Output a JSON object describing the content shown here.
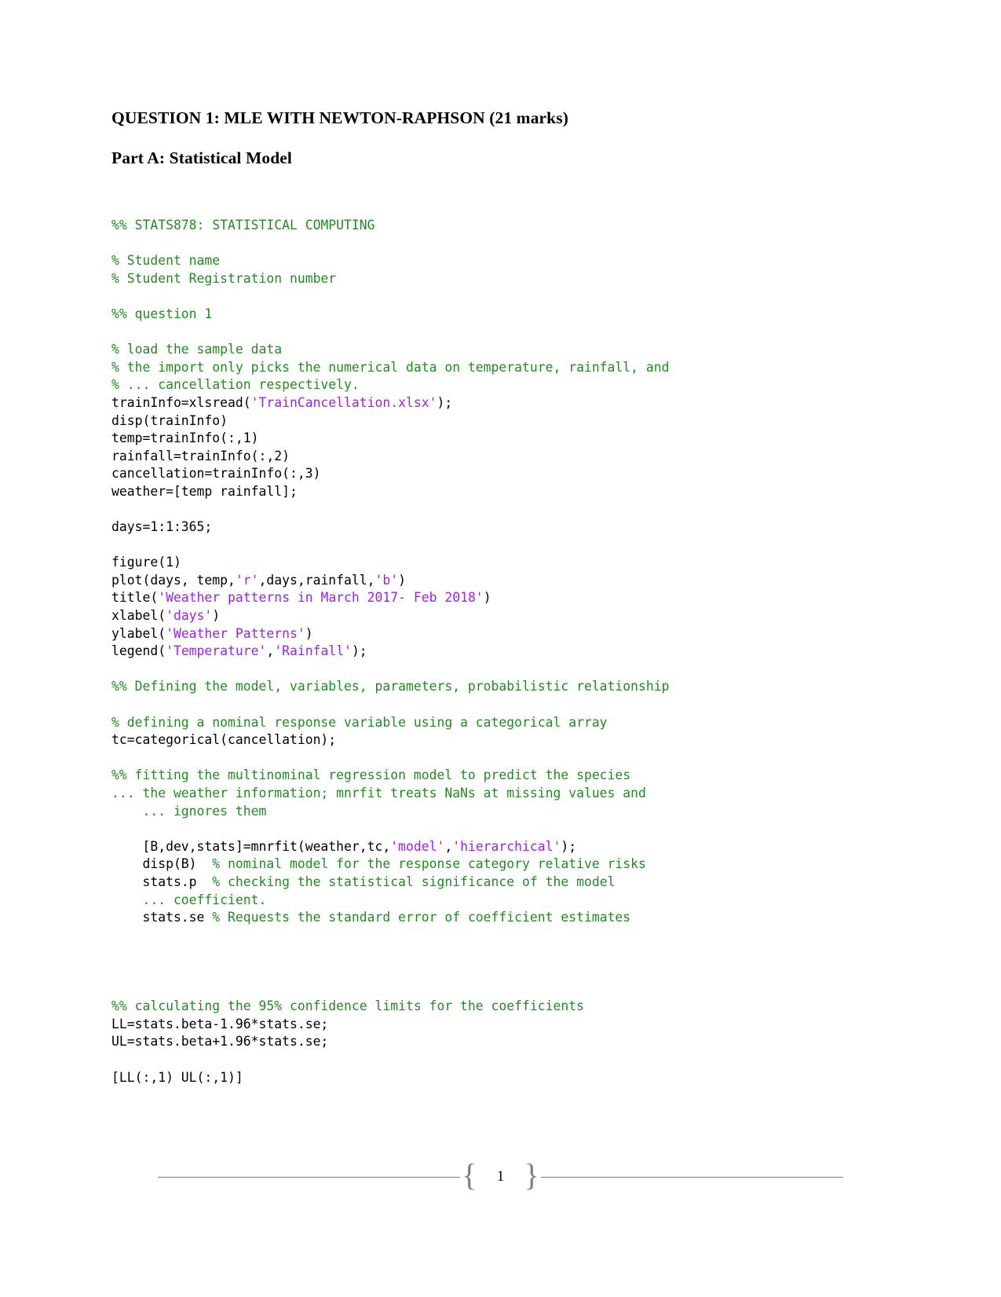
{
  "document": {
    "headings": [
      "QUESTION 1: MLE WITH NEWTON-RAPHSON (21 marks)",
      "Part A: Statistical Model"
    ]
  },
  "code": {
    "language": "MATLAB",
    "colors": {
      "comment": "#228B22",
      "string": "#A020F0",
      "code": "#000000",
      "background": "#FFFFFF"
    },
    "lines": [
      {
        "segments": [
          {
            "type": "comment",
            "text": "%% STATS878: STATISTICAL COMPUTING"
          }
        ]
      },
      {
        "segments": []
      },
      {
        "segments": [
          {
            "type": "comment",
            "text": "% Student name"
          }
        ]
      },
      {
        "segments": [
          {
            "type": "comment",
            "text": "% Student Registration number"
          }
        ]
      },
      {
        "segments": []
      },
      {
        "segments": [
          {
            "type": "comment",
            "text": "%% question 1"
          }
        ]
      },
      {
        "segments": []
      },
      {
        "segments": [
          {
            "type": "comment",
            "text": "% load the sample data"
          }
        ]
      },
      {
        "segments": [
          {
            "type": "comment",
            "text": "% the import only picks the numerical data on temperature, rainfall, and"
          }
        ]
      },
      {
        "segments": [
          {
            "type": "comment",
            "text": "% ... cancellation respectively."
          }
        ]
      },
      {
        "segments": [
          {
            "type": "code",
            "text": "trainInfo=xlsread("
          },
          {
            "type": "string",
            "text": "'TrainCancellation.xlsx'"
          },
          {
            "type": "code",
            "text": ");"
          }
        ]
      },
      {
        "segments": [
          {
            "type": "code",
            "text": "disp(trainInfo)"
          }
        ]
      },
      {
        "segments": [
          {
            "type": "code",
            "text": "temp=trainInfo(:,1)"
          }
        ]
      },
      {
        "segments": [
          {
            "type": "code",
            "text": "rainfall=trainInfo(:,2)"
          }
        ]
      },
      {
        "segments": [
          {
            "type": "code",
            "text": "cancellation=trainInfo(:,3)"
          }
        ]
      },
      {
        "segments": [
          {
            "type": "code",
            "text": "weather=[temp rainfall];"
          }
        ]
      },
      {
        "segments": []
      },
      {
        "segments": [
          {
            "type": "code",
            "text": "days=1:1:365;"
          }
        ]
      },
      {
        "segments": []
      },
      {
        "segments": [
          {
            "type": "code",
            "text": "figure(1)"
          }
        ]
      },
      {
        "segments": [
          {
            "type": "code",
            "text": "plot(days, temp,"
          },
          {
            "type": "string",
            "text": "'r'"
          },
          {
            "type": "code",
            "text": ",days,rainfall,"
          },
          {
            "type": "string",
            "text": "'b'"
          },
          {
            "type": "code",
            "text": ")"
          }
        ]
      },
      {
        "segments": [
          {
            "type": "code",
            "text": "title("
          },
          {
            "type": "string",
            "text": "'Weather patterns in March 2017- Feb 2018'"
          },
          {
            "type": "code",
            "text": ")"
          }
        ]
      },
      {
        "segments": [
          {
            "type": "code",
            "text": "xlabel("
          },
          {
            "type": "string",
            "text": "'days'"
          },
          {
            "type": "code",
            "text": ")"
          }
        ]
      },
      {
        "segments": [
          {
            "type": "code",
            "text": "ylabel("
          },
          {
            "type": "string",
            "text": "'Weather Patterns'"
          },
          {
            "type": "code",
            "text": ")"
          }
        ]
      },
      {
        "segments": [
          {
            "type": "code",
            "text": "legend("
          },
          {
            "type": "string",
            "text": "'Temperature'"
          },
          {
            "type": "code",
            "text": ","
          },
          {
            "type": "string",
            "text": "'Rainfall'"
          },
          {
            "type": "code",
            "text": ");"
          }
        ]
      },
      {
        "segments": []
      },
      {
        "segments": [
          {
            "type": "comment",
            "text": "%% Defining the model, variables, parameters, probabilistic relationship"
          }
        ]
      },
      {
        "segments": []
      },
      {
        "segments": [
          {
            "type": "comment",
            "text": "% defining a nominal response variable using a categorical array"
          }
        ]
      },
      {
        "segments": [
          {
            "type": "code",
            "text": "tc=categorical(cancellation);"
          }
        ]
      },
      {
        "segments": []
      },
      {
        "segments": [
          {
            "type": "comment",
            "text": "%% fitting the multinominal regression model to predict the species"
          }
        ]
      },
      {
        "segments": [
          {
            "type": "comment",
            "text": "... the weather information; mnrfit treats NaNs at missing values and"
          }
        ]
      },
      {
        "segments": [
          {
            "type": "comment",
            "text": "    ... ignores them"
          }
        ]
      },
      {
        "segments": []
      },
      {
        "segments": [
          {
            "type": "code",
            "text": "    [B,dev,stats]=mnrfit(weather,tc,"
          },
          {
            "type": "string",
            "text": "'model'"
          },
          {
            "type": "code",
            "text": ","
          },
          {
            "type": "string",
            "text": "'hierarchical'"
          },
          {
            "type": "code",
            "text": ");"
          }
        ]
      },
      {
        "segments": [
          {
            "type": "code",
            "text": "    disp(B)  "
          },
          {
            "type": "comment",
            "text": "% nominal model for the response category relative risks"
          }
        ]
      },
      {
        "segments": [
          {
            "type": "code",
            "text": "    stats.p  "
          },
          {
            "type": "comment",
            "text": "% checking the statistical significance of the model"
          }
        ]
      },
      {
        "segments": [
          {
            "type": "comment",
            "text": "    ... coefficient."
          }
        ]
      },
      {
        "segments": [
          {
            "type": "code",
            "text": "    stats.se "
          },
          {
            "type": "comment",
            "text": "% Requests the standard error of coefficient estimates"
          }
        ]
      },
      {
        "segments": []
      },
      {
        "segments": []
      },
      {
        "segments": []
      },
      {
        "segments": []
      },
      {
        "segments": [
          {
            "type": "comment",
            "text": "%% calculating the 95% confidence limits for the coefficients"
          }
        ]
      },
      {
        "segments": [
          {
            "type": "code",
            "text": "LL=stats.beta-1.96*stats.se;"
          }
        ]
      },
      {
        "segments": [
          {
            "type": "code",
            "text": "UL=stats.beta+1.96*stats.se;"
          }
        ]
      },
      {
        "segments": []
      },
      {
        "segments": [
          {
            "type": "code",
            "text": "[LL(:,1) UL(:,1)]"
          }
        ]
      }
    ]
  },
  "footer": {
    "page_number": "1",
    "brace_left": "{",
    "brace_right": "}"
  }
}
